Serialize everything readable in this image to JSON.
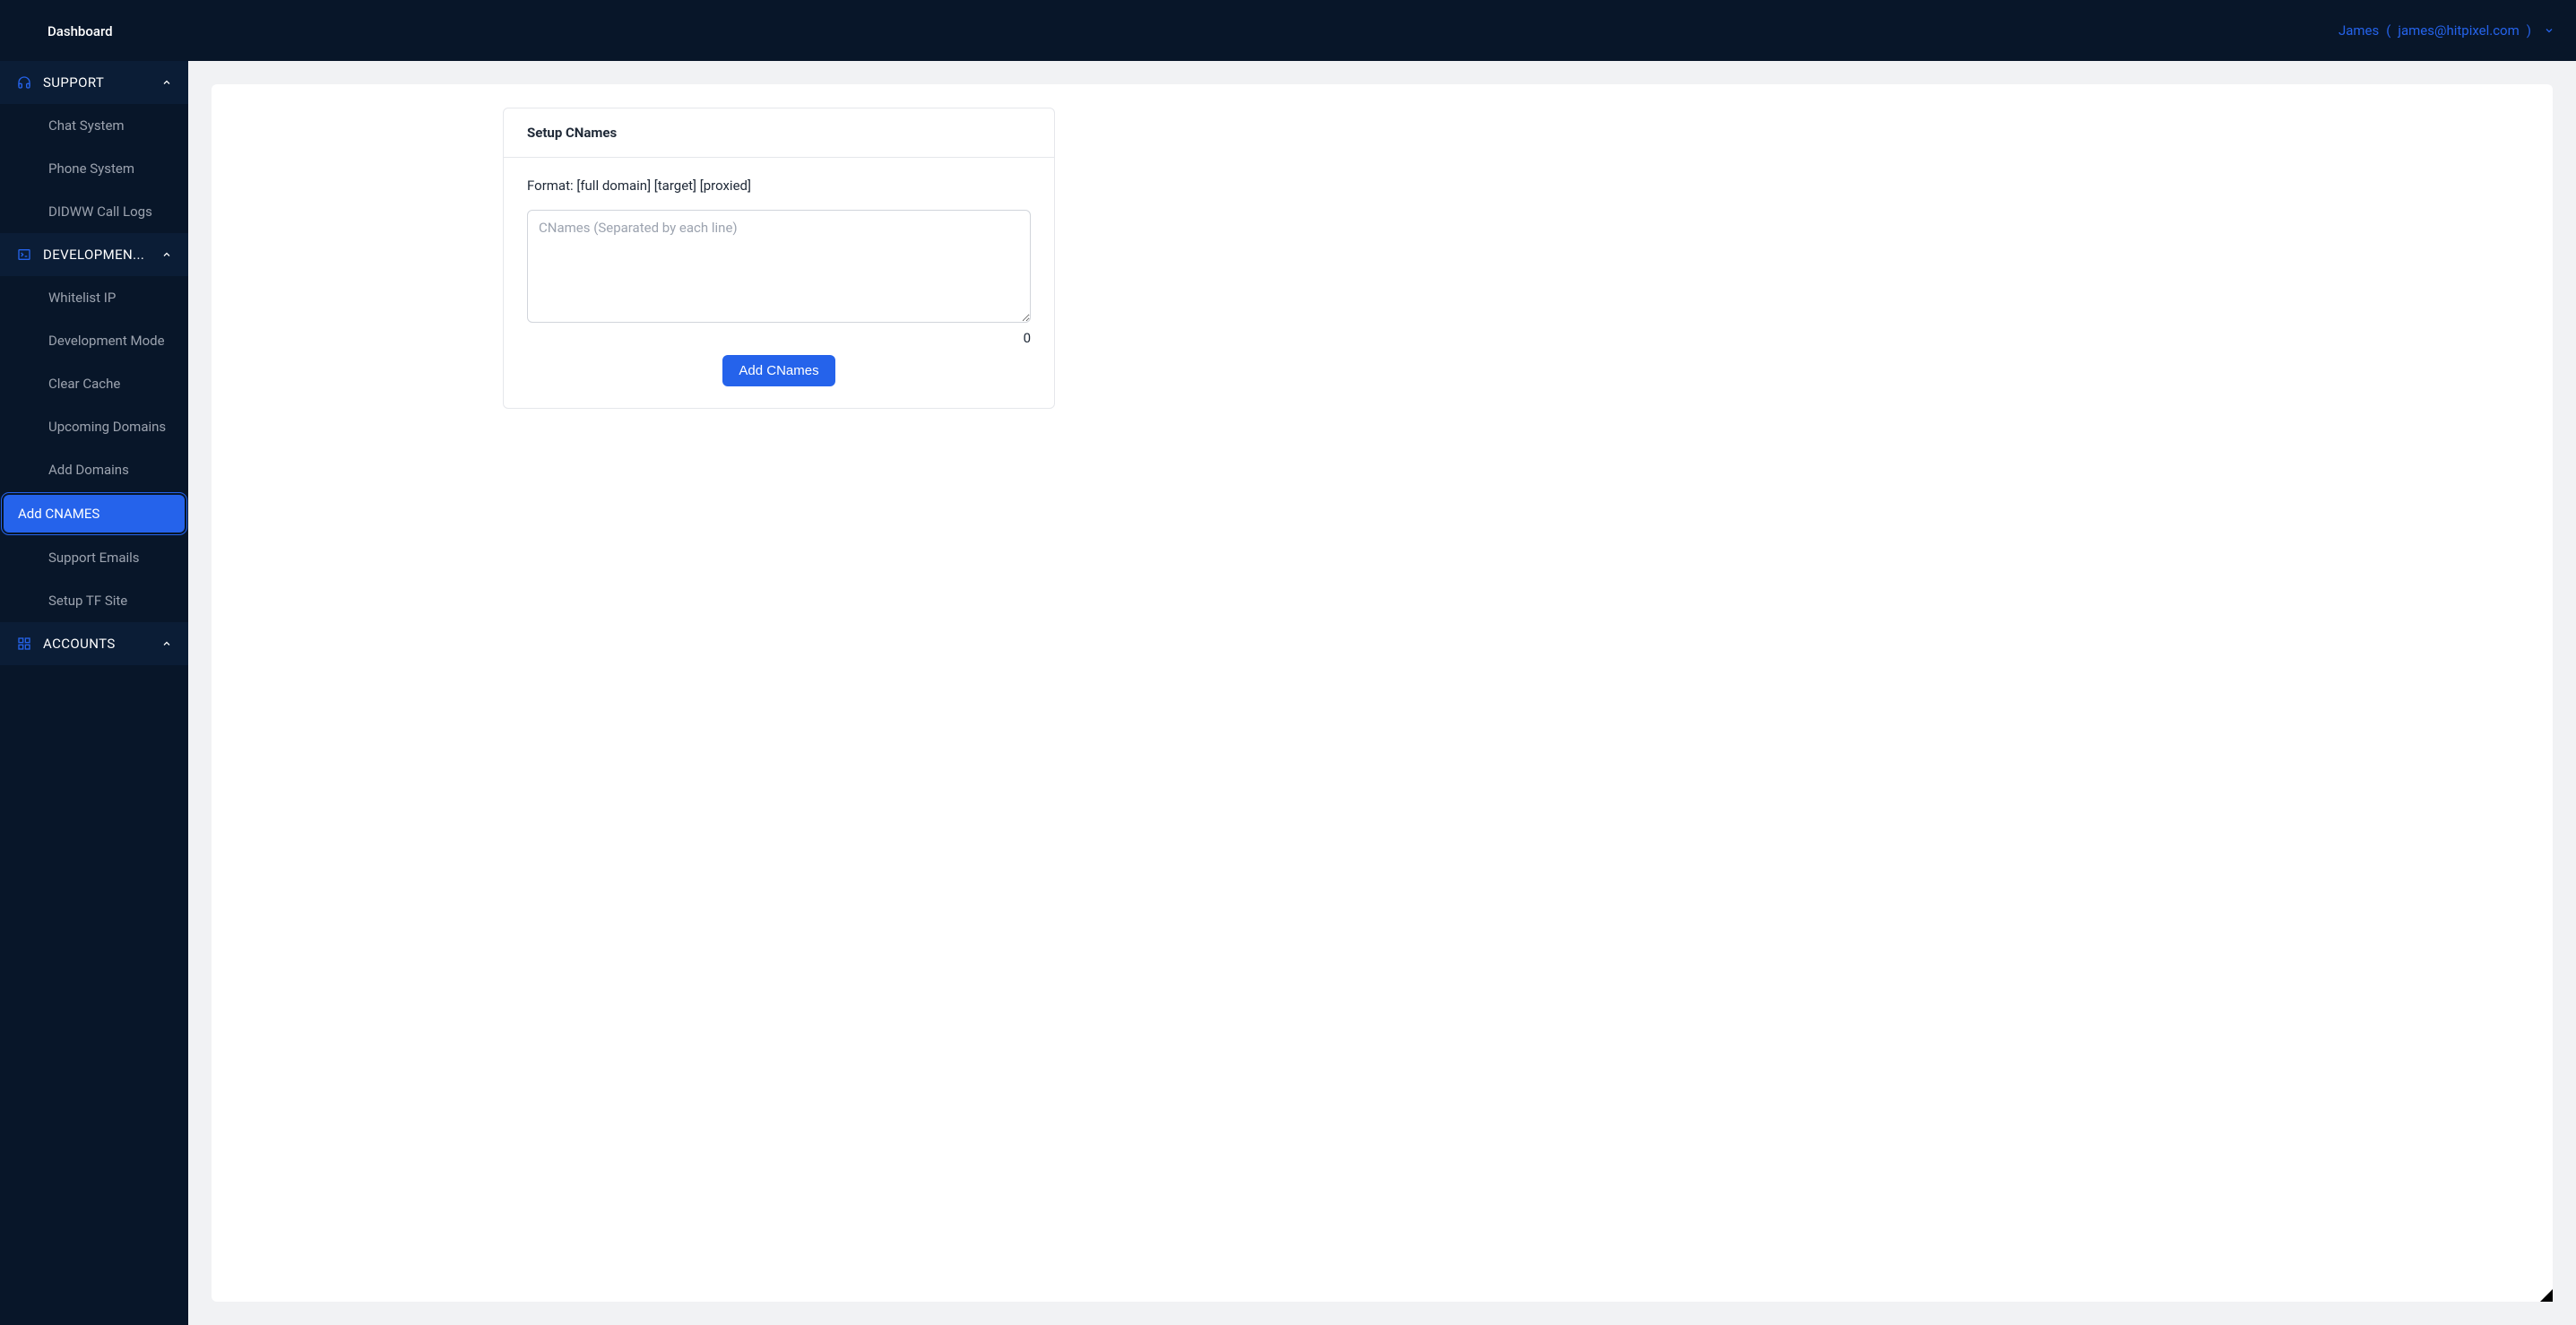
{
  "topbar": {
    "title": "Dashboard",
    "user_name": "James",
    "user_paren_open": "(",
    "user_email": "james@hitpixel.com",
    "user_paren_close": ")"
  },
  "sidebar": {
    "sections": [
      {
        "label": "SUPPORT",
        "items": [
          {
            "label": "Chat System"
          },
          {
            "label": "Phone System"
          },
          {
            "label": "DIDWW Call Logs"
          }
        ]
      },
      {
        "label": "DEVELOPMEN...",
        "items": [
          {
            "label": "Whitelist IP"
          },
          {
            "label": "Development Mode"
          },
          {
            "label": "Clear Cache"
          },
          {
            "label": "Upcoming Domains"
          },
          {
            "label": "Add Domains"
          },
          {
            "label": "Add CNAMES",
            "active": true
          },
          {
            "label": "Support Emails"
          },
          {
            "label": "Setup TF Site"
          }
        ]
      },
      {
        "label": "ACCOUNTS",
        "items": []
      }
    ]
  },
  "main": {
    "card": {
      "title": "Setup CNames",
      "format_label": "Format: [full domain] [target] [proxied]",
      "textarea_placeholder": "CNames (Separated by each line)",
      "textarea_value": "",
      "counter": "0",
      "add_button_label": "Add CNames"
    }
  }
}
